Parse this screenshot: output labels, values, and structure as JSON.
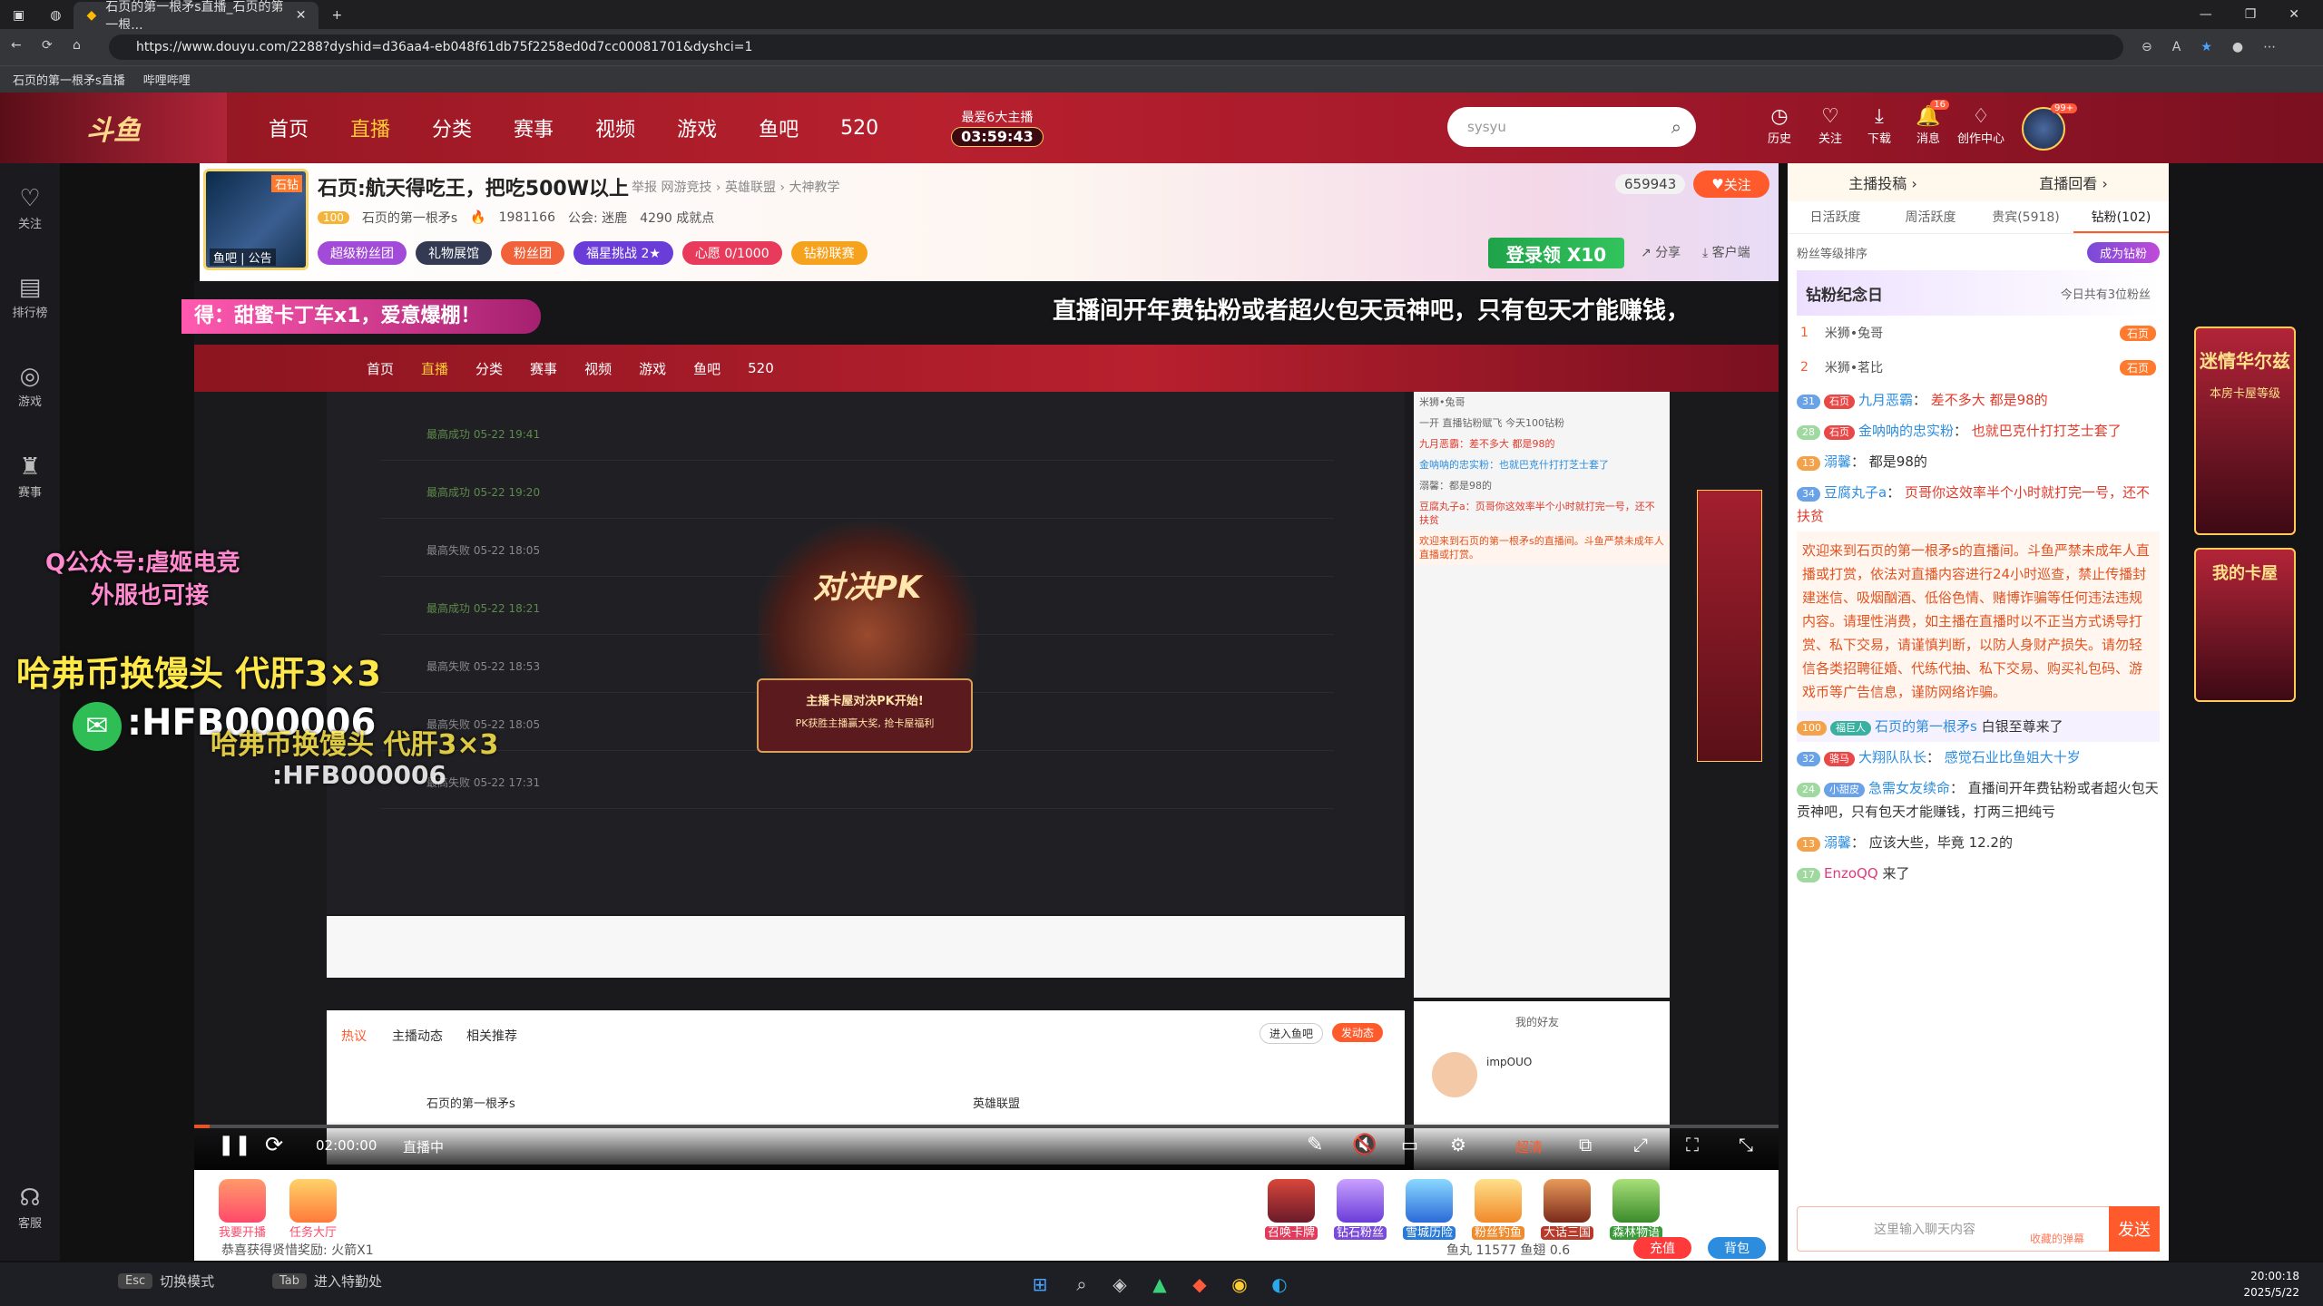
{
  "browser": {
    "tab_title": "石页的第一根矛s直播_石页的第一根...",
    "url": "https://www.douyu.com/2288?dyshid=d36aa4-eb048f61db75f2258ed0d7cc00081701&dyshci=1",
    "bookmarks": [
      "石页的第一根矛s直播",
      "哔哩哔哩"
    ]
  },
  "topnav": {
    "logo": "斗鱼",
    "items": [
      "首页",
      "直播",
      "分类",
      "赛事",
      "视频",
      "游戏",
      "鱼吧",
      "520"
    ],
    "active": "直播",
    "countdown_label": "最爱6大主播",
    "countdown_time": "03:59:43",
    "search_placeholder": "sysyu",
    "icons": [
      {
        "label": "历史",
        "glyph": "◷"
      },
      {
        "label": "关注",
        "glyph": "♡"
      },
      {
        "label": "下载",
        "glyph": "⤓"
      },
      {
        "label": "消息",
        "glyph": "🔔",
        "badge": "16"
      },
      {
        "label": "创作中心",
        "glyph": "♢"
      }
    ],
    "avatar_badge": "99+"
  },
  "leftrail": [
    {
      "label": "关注",
      "glyph": "♡"
    },
    {
      "label": "排行榜",
      "glyph": "▤"
    },
    {
      "label": "游戏",
      "glyph": "◎"
    },
    {
      "label": "赛事",
      "glyph": "♜"
    },
    {
      "label": "客服",
      "glyph": "☊"
    }
  ],
  "room": {
    "title": "石页:航天得吃王，把吃500W以上",
    "meta": "举报   网游竞技 › 英雄联盟 › 大神教学",
    "level": "100",
    "streamer": "石页的第一根矛s",
    "hot": "1981166",
    "guild": "公会: 迷鹿",
    "fans": "4290 成就点",
    "avatar_tags": "鱼吧 | 公告",
    "avatar_corner": "石钻",
    "badges": [
      "超级粉丝团",
      "礼物展馆",
      "粉丝团",
      "福星挑战 2★",
      "心愿 0/1000",
      "钻粉联赛"
    ],
    "viewers": "659943",
    "follow": "关注",
    "login_promo": "登录领 X10",
    "share": "分享",
    "client": "客户端"
  },
  "player": {
    "ticker_right": "直播间开年费钻粉或者超火包天贡神吧，只有包天才能赚钱，",
    "ticker_left": "得：甜蜜卡丁车x1，爱意爆棚！",
    "watermark_1": "Q公众号:虐姬电竞",
    "watermark_2": "外服也可接",
    "watermark_3": "哈弗币换馒头 代肝3×3",
    "watermark_4": ":HFB000006",
    "watermark_5": "哈弗币换馒头 代肝3×3",
    "watermark_6": ":HFB000006",
    "pk_title": "对决PK",
    "pk_banner_1": "主播卡屋对决PK开始!",
    "pk_banner_2": "PK获胜主播赢大奖, 抢卡屋福利",
    "time": "02:00:00",
    "status": "直播中",
    "quality": "超清",
    "progress_fraction": 0.01,
    "mini_rows": [
      "最高成功 05-22 19:41",
      "最高成功 05-22 19:20",
      "最高失败 05-22 18:05",
      "最高成功 05-22 18:21",
      "最高失败 05-22 18:53",
      "最高失败 05-22 18:05",
      "最高失败 05-22 17:31"
    ],
    "mini_tabs": [
      "热议",
      "主播动态",
      "相关推荐"
    ],
    "mini_enter": "进入鱼吧",
    "mini_post": "发动态",
    "mini_topic_1": "石页的第一根矛s",
    "mini_topic_2": "英雄联盟",
    "mini_friend": "impOUO",
    "mini_friends_title": "我的好友",
    "mini_chat": [
      "米狮•兔哥",
      "一开 直播钻粉赋飞 今天100钻粉",
      "九月恶霸：差不多大 都是98的",
      "金呐呐的忠实粉：也就巴克什打打芝士套了",
      "溺馨：都是98的",
      "豆腐丸子a：页哥你这效率半个小时就打完一号，还不扶贫",
      "欢迎来到石页的第一根矛s的直播间。斗鱼严禁未成年人直播或打赏。"
    ]
  },
  "gifts": [
    "我要开播",
    "任务大厅",
    "召唤卡牌",
    "钻石粉丝",
    "雪城历险",
    "粉丝钓鱼",
    "大话三国",
    "森林物语"
  ],
  "gift_footer": "恭喜获得贤惜奖励: 火箭X1",
  "gift_balance": "鱼丸 11577   鱼翅 0.6",
  "gift_btn_charge": "充值",
  "gift_btn_bag": "背包",
  "right": {
    "top_links": [
      "主播投稿 ›",
      "直播回看 ›"
    ],
    "tabs": [
      "日活跃度",
      "周活跃度",
      "贵宾(5918)",
      "钻粉(102)"
    ],
    "active_tab": "钻粉(102)",
    "fan_sort": "粉丝等级排序",
    "become_fan": "成为钻粉",
    "fan_day": "钻粉纪念日",
    "fan_day_note": "今日共有3位粉丝",
    "ranks": [
      {
        "n": "1",
        "name": "米狮•兔哥",
        "tag": "石页"
      },
      {
        "n": "2",
        "name": "米狮•茗比",
        "tag": "石页"
      }
    ],
    "messages": [
      {
        "lv": "31",
        "badge": "石页",
        "name": "九月恶霸",
        "text": "差不多大 都是98的",
        "hot": true
      },
      {
        "lv": "28",
        "badge": "石页",
        "name": "金呐呐的忠实粉",
        "text": "也就巴克什打打芝士套了",
        "hot": true
      },
      {
        "lv": "13",
        "badge": "",
        "name": "溺馨",
        "text": "都是98的",
        "hot": false
      },
      {
        "lv": "34",
        "badge": "",
        "name": "豆腐丸子a",
        "text": "页哥你这效率半个小时就打完一号，还不扶贫",
        "hot": true
      },
      {
        "sys": "欢迎来到石页的第一根矛s的直播间。斗鱼严禁未成年人直播或打赏，依法对直播内容进行24小时巡查，禁止传播封建迷信、吸烟酗酒、低俗色情、赌博诈骗等任何违法违规内容。请理性消费，如主播在直播时以不正当方式诱导打赏、私下交易，请谨慎判断，以防人身财产损失。请勿轻信各类招聘征婚、代练代抽、私下交易、购买礼包码、游戏币等广告信息，谨防网络诈骗。"
      },
      {
        "lv": "100",
        "badge": "福巨人",
        "name": "石页的第一根矛s",
        "text": "白银至尊来了",
        "hot": false,
        "enter": true
      },
      {
        "lv": "32",
        "badge": "骆马",
        "name": "大翔队队长",
        "text": "感觉石业比鱼姐大十岁",
        "hot": true
      },
      {
        "lv": "24",
        "badge": "小甜皮",
        "name": "急需女友续命",
        "text": "直播间开年费钻粉或者超火包天贡神吧，只有包天才能赚钱，打两三把纯亏",
        "hot": false
      },
      {
        "lv": "13",
        "badge": "",
        "name": "溺馨",
        "text": "应该大些，毕竟 12.2的",
        "hot": false
      },
      {
        "lv": "17",
        "badge": "",
        "name": "EnzoQQ",
        "text": "来了",
        "hot": false,
        "enter": true
      }
    ],
    "chat_placeholder": "这里输入聊天内容",
    "chat_hint": "收藏的弹幕",
    "send": "发送"
  },
  "farright": [
    "迷情华尔兹",
    "本房卡屋等级",
    "我的卡屋"
  ],
  "taskbar": {
    "hint_1_key": "Esc",
    "hint_1": "切换模式",
    "hint_2_key": "Tab",
    "hint_2": "进入特勤处",
    "time": "20:00:18",
    "date": "2025/5/22"
  },
  "colors": {
    "brand": "#b8202e",
    "accent": "#ff5a2c"
  }
}
